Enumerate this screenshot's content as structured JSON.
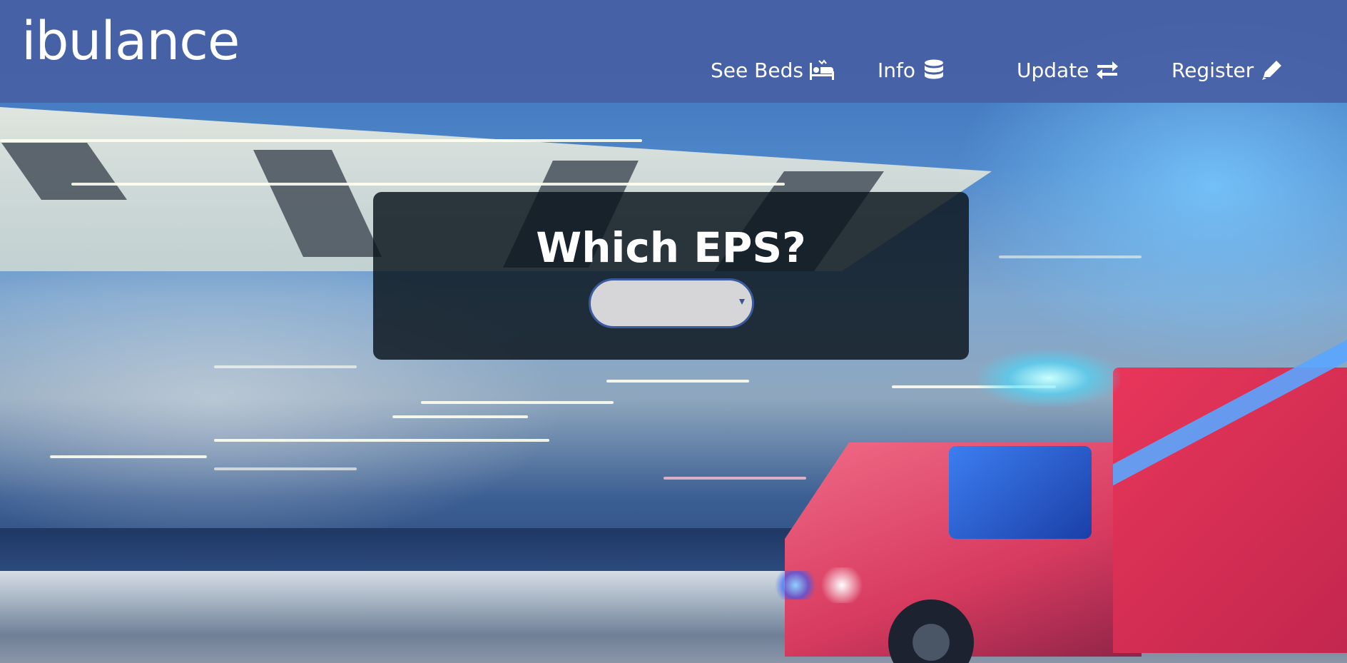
{
  "header": {
    "logo": "ibulance",
    "nav": [
      {
        "label": "See Beds",
        "icon": "bed-icon"
      },
      {
        "label": "Info",
        "icon": "database-icon"
      },
      {
        "label": "Update",
        "icon": "exchange-arrows-icon"
      },
      {
        "label": "Register",
        "icon": "pencil-icon"
      }
    ]
  },
  "main": {
    "title": "Which EPS?",
    "eps_select": {
      "value": ""
    }
  },
  "colors": {
    "header_bg": "#4860a5",
    "panel_bg": "#0c161e",
    "select_border": "#3c5a9e",
    "select_bg": "#d6d6d9"
  }
}
